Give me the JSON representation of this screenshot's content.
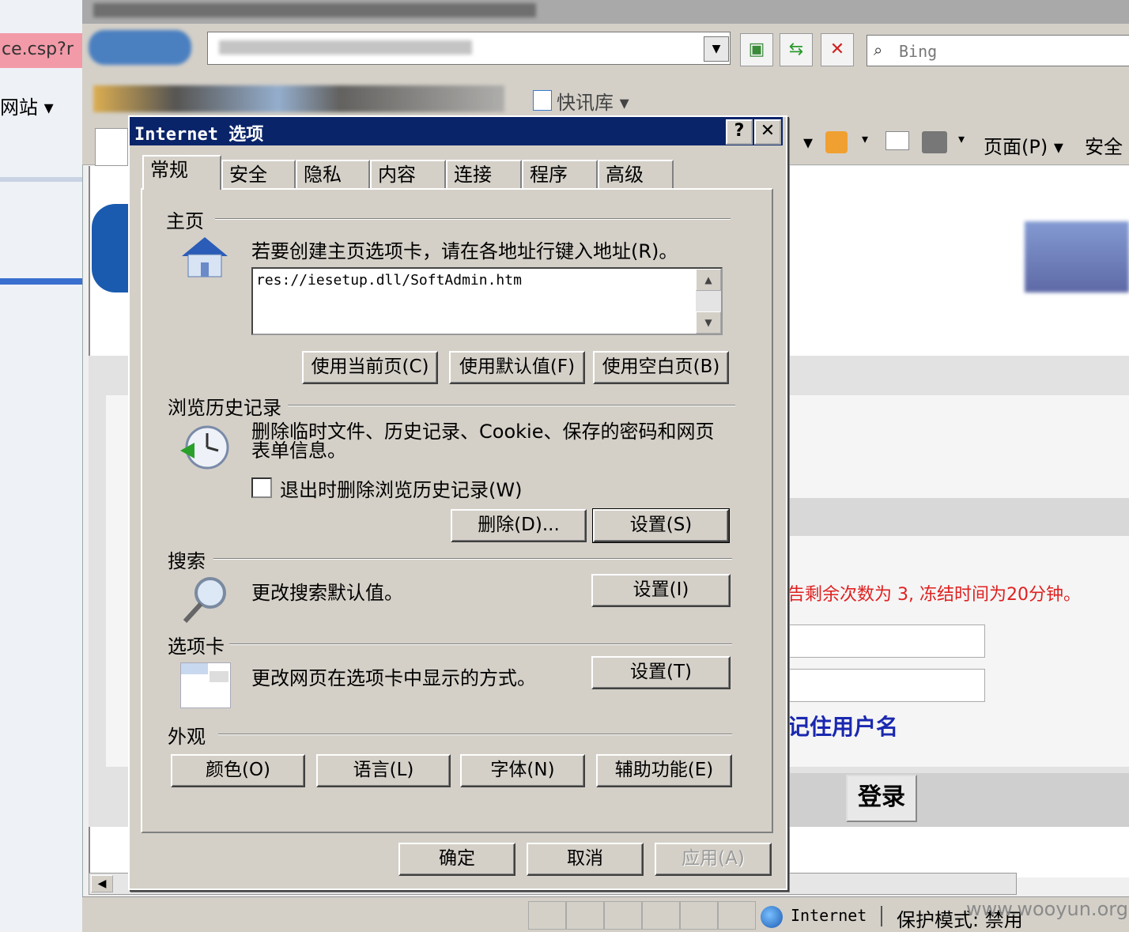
{
  "browser": {
    "tab_partial_text": "ce.csp?r",
    "fav_left": "网站",
    "fav_kuaixun": "快讯库",
    "search_placeholder": "Bing",
    "cmd_page": "页面(P)",
    "cmd_safety": "安全"
  },
  "webpage": {
    "warning_text": "告剩余次数为 3, 冻结时间为20分钟。",
    "remember_username": "记住用户名",
    "login_button": "登录"
  },
  "status": {
    "zone": "Internet",
    "protected_mode": "保护模式: 禁用",
    "watermark": "www.wooyun.org"
  },
  "dialog": {
    "title": "Internet 选项",
    "help_btn": "?",
    "close_btn": "✕",
    "tabs": [
      "常规",
      "安全",
      "隐私",
      "内容",
      "连接",
      "程序",
      "高级"
    ],
    "home": {
      "label": "主页",
      "description": "若要创建主页选项卡，请在各地址行键入地址(R)。",
      "url": "res://iesetup.dll/SoftAdmin.htm",
      "btn_current": "使用当前页(C)",
      "btn_default": "使用默认值(F)",
      "btn_blank": "使用空白页(B)"
    },
    "history": {
      "label": "浏览历史记录",
      "description": "删除临时文件、历史记录、Cookie、保存的密码和网页表单信息。",
      "checkbox_label": "退出时删除浏览历史记录(W)",
      "btn_delete": "删除(D)...",
      "btn_settings": "设置(S)"
    },
    "search": {
      "label": "搜索",
      "description": "更改搜索默认值。",
      "btn_settings": "设置(I)"
    },
    "tabs_group": {
      "label": "选项卡",
      "description": "更改网页在选项卡中显示的方式。",
      "btn_settings": "设置(T)"
    },
    "appearance": {
      "label": "外观",
      "btn_colors": "颜色(O)",
      "btn_languages": "语言(L)",
      "btn_fonts": "字体(N)",
      "btn_accessibility": "辅助功能(E)"
    },
    "footer": {
      "ok": "确定",
      "cancel": "取消",
      "apply": "应用(A)"
    }
  }
}
